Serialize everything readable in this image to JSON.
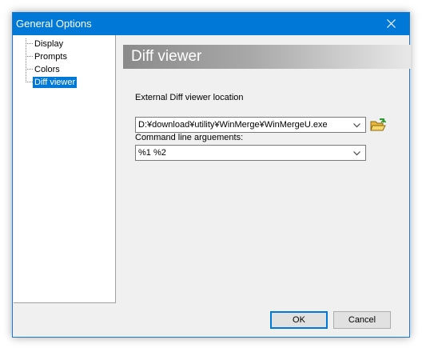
{
  "window": {
    "title": "General Options"
  },
  "tree": {
    "items": [
      {
        "label": "Display",
        "selected": false
      },
      {
        "label": "Prompts",
        "selected": false
      },
      {
        "label": "Colors",
        "selected": false
      },
      {
        "label": "Diff viewer",
        "selected": true
      }
    ]
  },
  "panel": {
    "heading": "Diff viewer",
    "diff_viewer_location": {
      "label": "External Diff viewer location",
      "value": "D:¥download¥utility¥WinMerge¥WinMergeU.exe"
    },
    "command_line": {
      "label": "Command line arguements:",
      "value": "%1 %2"
    },
    "browse_icon": "open-folder-icon"
  },
  "buttons": {
    "ok": "OK",
    "cancel": "Cancel"
  },
  "colors": {
    "titlebar": "#0078d7",
    "selection": "#0078d7"
  }
}
